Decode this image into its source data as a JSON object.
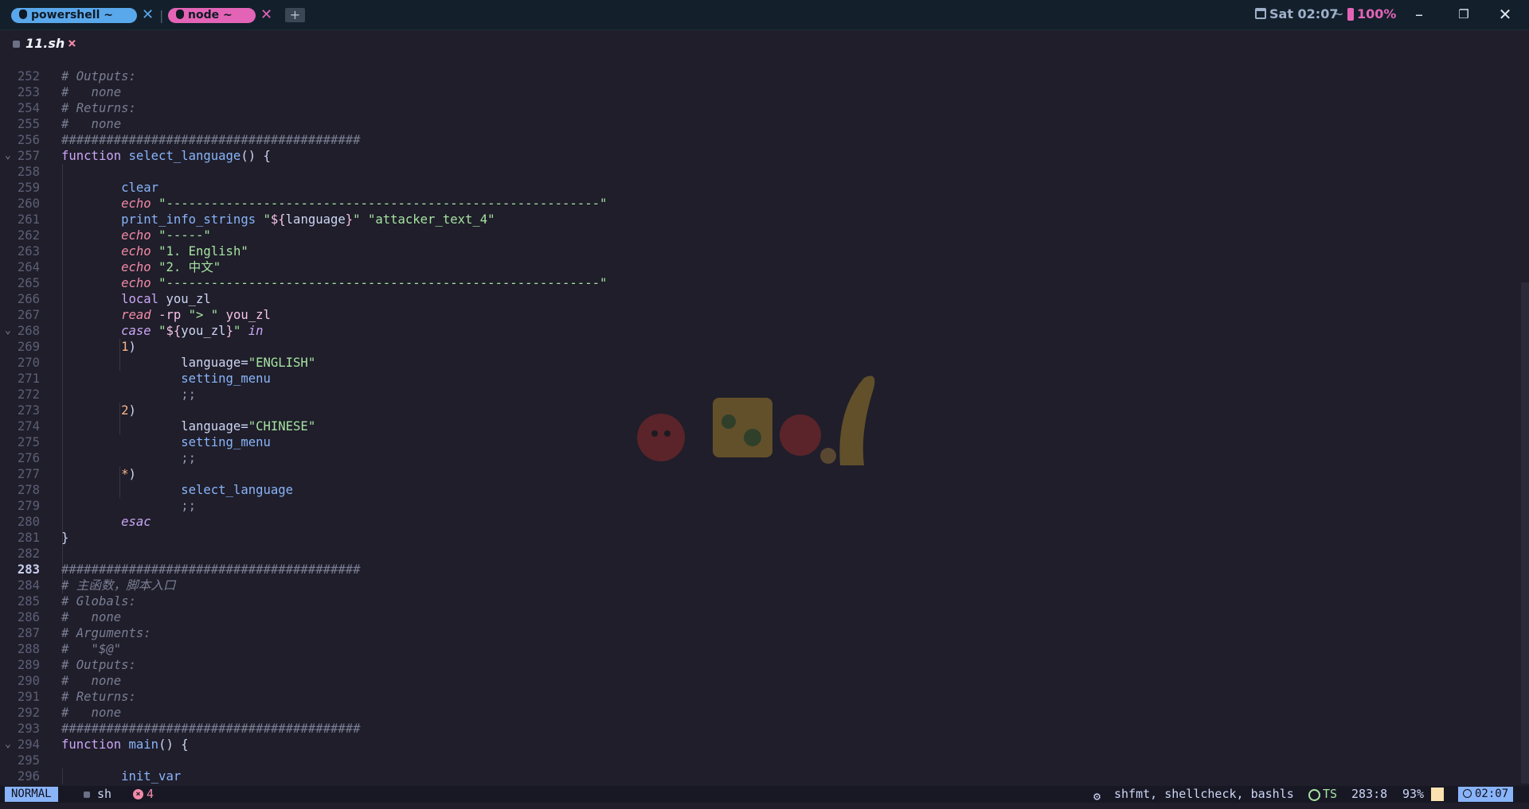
{
  "tabs": [
    {
      "label": "powershell ~",
      "color": "#5aa8ec"
    },
    {
      "label": "node ~",
      "color": "#e364b7"
    }
  ],
  "tab_separator": "|",
  "add_tab_label": "+",
  "top_status": {
    "datetime": "Sat 02:07",
    "tilde": "~",
    "battery": "100%"
  },
  "window_controls": {
    "minimize": "–",
    "maximize": "❐",
    "close": "✕"
  },
  "buffer": {
    "name": "11.sh",
    "close": "×"
  },
  "editor": {
    "lines": [
      {
        "n": "252",
        "t": [
          [
            "c-comment",
            "# Outputs:"
          ]
        ]
      },
      {
        "n": "253",
        "t": [
          [
            "c-comment",
            "#   none"
          ]
        ]
      },
      {
        "n": "254",
        "t": [
          [
            "c-comment",
            "# Returns:"
          ]
        ]
      },
      {
        "n": "255",
        "t": [
          [
            "c-comment",
            "#   none"
          ]
        ]
      },
      {
        "n": "256",
        "t": [
          [
            "c-hash",
            "########################################"
          ]
        ]
      },
      {
        "n": "257",
        "fold": true,
        "t": [
          [
            "c-kw",
            "function "
          ],
          [
            "c-fn",
            "select_language"
          ],
          [
            "c-plain",
            "() {"
          ]
        ]
      },
      {
        "n": "258",
        "t": []
      },
      {
        "n": "259",
        "t": [
          [
            "c-plain",
            "        "
          ],
          [
            "c-fn",
            "clear"
          ]
        ]
      },
      {
        "n": "260",
        "t": [
          [
            "c-plain",
            "        "
          ],
          [
            "c-builtin",
            "echo"
          ],
          [
            "c-plain",
            " "
          ],
          [
            "c-str",
            "\"----------------------------------------------------------\""
          ]
        ]
      },
      {
        "n": "261",
        "t": [
          [
            "c-plain",
            "        "
          ],
          [
            "c-fn",
            "print_info_strings"
          ],
          [
            "c-plain",
            " "
          ],
          [
            "c-str",
            "\""
          ],
          [
            "c-var",
            "${"
          ],
          [
            "c-plain",
            "language"
          ],
          [
            "c-var",
            "}"
          ],
          [
            "c-str",
            "\" \"attacker_text_4\""
          ]
        ]
      },
      {
        "n": "262",
        "t": [
          [
            "c-plain",
            "        "
          ],
          [
            "c-builtin",
            "echo"
          ],
          [
            "c-plain",
            " "
          ],
          [
            "c-str",
            "\"-----\""
          ]
        ]
      },
      {
        "n": "263",
        "t": [
          [
            "c-plain",
            "        "
          ],
          [
            "c-builtin",
            "echo"
          ],
          [
            "c-plain",
            " "
          ],
          [
            "c-str",
            "\"1. English\""
          ]
        ]
      },
      {
        "n": "264",
        "t": [
          [
            "c-plain",
            "        "
          ],
          [
            "c-builtin",
            "echo"
          ],
          [
            "c-plain",
            " "
          ],
          [
            "c-str",
            "\"2. 中文\""
          ]
        ]
      },
      {
        "n": "265",
        "t": [
          [
            "c-plain",
            "        "
          ],
          [
            "c-builtin",
            "echo"
          ],
          [
            "c-plain",
            " "
          ],
          [
            "c-str",
            "\"----------------------------------------------------------\""
          ]
        ]
      },
      {
        "n": "266",
        "t": [
          [
            "c-plain",
            "        "
          ],
          [
            "c-kw",
            "local"
          ],
          [
            "c-plain",
            " you_zl"
          ]
        ]
      },
      {
        "n": "267",
        "t": [
          [
            "c-plain",
            "        "
          ],
          [
            "c-builtin",
            "read"
          ],
          [
            "c-plain",
            " "
          ],
          [
            "c-var",
            "-rp"
          ],
          [
            "c-plain",
            " "
          ],
          [
            "c-str",
            "\"> \""
          ],
          [
            "c-plain",
            " "
          ],
          [
            "c-var",
            "you_zl"
          ]
        ]
      },
      {
        "n": "268",
        "fold": true,
        "t": [
          [
            "c-plain",
            "        "
          ],
          [
            "c-ctl",
            "case"
          ],
          [
            "c-plain",
            " "
          ],
          [
            "c-str",
            "\""
          ],
          [
            "c-var",
            "${"
          ],
          [
            "c-plain",
            "you_zl"
          ],
          [
            "c-var",
            "}"
          ],
          [
            "c-str",
            "\""
          ],
          [
            "c-plain",
            " "
          ],
          [
            "c-ctl",
            "in"
          ]
        ]
      },
      {
        "n": "269",
        "t": [
          [
            "c-plain",
            "        "
          ],
          [
            "c-num",
            "1"
          ],
          [
            "c-plain",
            ")"
          ]
        ]
      },
      {
        "n": "270",
        "t": [
          [
            "c-plain",
            "                language="
          ],
          [
            "c-str",
            "\"ENGLISH\""
          ]
        ]
      },
      {
        "n": "271",
        "t": [
          [
            "c-plain",
            "                "
          ],
          [
            "c-fn",
            "setting_menu"
          ]
        ]
      },
      {
        "n": "272",
        "t": [
          [
            "c-plain",
            "                "
          ],
          [
            "c-punct",
            ";;"
          ]
        ]
      },
      {
        "n": "273",
        "t": [
          [
            "c-plain",
            "        "
          ],
          [
            "c-num",
            "2"
          ],
          [
            "c-plain",
            ")"
          ]
        ]
      },
      {
        "n": "274",
        "t": [
          [
            "c-plain",
            "                language="
          ],
          [
            "c-str",
            "\"CHINESE\""
          ]
        ]
      },
      {
        "n": "275",
        "t": [
          [
            "c-plain",
            "                "
          ],
          [
            "c-fn",
            "setting_menu"
          ]
        ]
      },
      {
        "n": "276",
        "t": [
          [
            "c-plain",
            "                "
          ],
          [
            "c-punct",
            ";;"
          ]
        ]
      },
      {
        "n": "277",
        "t": [
          [
            "c-plain",
            "        "
          ],
          [
            "c-num",
            "*"
          ],
          [
            "c-plain",
            ")"
          ]
        ]
      },
      {
        "n": "278",
        "t": [
          [
            "c-plain",
            "                "
          ],
          [
            "c-fn",
            "select_language"
          ]
        ]
      },
      {
        "n": "279",
        "t": [
          [
            "c-plain",
            "                "
          ],
          [
            "c-punct",
            ";;"
          ]
        ]
      },
      {
        "n": "280",
        "t": [
          [
            "c-plain",
            "        "
          ],
          [
            "c-ctl",
            "esac"
          ]
        ]
      },
      {
        "n": "281",
        "t": [
          [
            "c-plain",
            "}"
          ]
        ]
      },
      {
        "n": "282",
        "t": []
      },
      {
        "n": "283",
        "current": true,
        "t": [
          [
            "c-hash",
            "########################################"
          ]
        ]
      },
      {
        "n": "284",
        "t": [
          [
            "c-comment",
            "# 主函数，脚本入口"
          ]
        ]
      },
      {
        "n": "285",
        "t": [
          [
            "c-comment",
            "# Globals:"
          ]
        ]
      },
      {
        "n": "286",
        "t": [
          [
            "c-comment",
            "#   none"
          ]
        ]
      },
      {
        "n": "287",
        "t": [
          [
            "c-comment",
            "# Arguments:"
          ]
        ]
      },
      {
        "n": "288",
        "t": [
          [
            "c-comment",
            "#   \"$@\""
          ]
        ]
      },
      {
        "n": "289",
        "t": [
          [
            "c-comment",
            "# Outputs:"
          ]
        ]
      },
      {
        "n": "290",
        "t": [
          [
            "c-comment",
            "#   none"
          ]
        ]
      },
      {
        "n": "291",
        "t": [
          [
            "c-comment",
            "# Returns:"
          ]
        ]
      },
      {
        "n": "292",
        "t": [
          [
            "c-comment",
            "#   none"
          ]
        ]
      },
      {
        "n": "293",
        "t": [
          [
            "c-hash",
            "########################################"
          ]
        ]
      },
      {
        "n": "294",
        "fold": true,
        "t": [
          [
            "c-kw",
            "function "
          ],
          [
            "c-fn",
            "main"
          ],
          [
            "c-plain",
            "() {"
          ]
        ]
      },
      {
        "n": "295",
        "t": []
      },
      {
        "n": "296",
        "t": [
          [
            "c-plain",
            "        "
          ],
          [
            "c-fn",
            "init_var"
          ]
        ]
      }
    ]
  },
  "statusline": {
    "mode": "NORMAL",
    "filetype": "sh",
    "errors": "4",
    "error_icon": "×",
    "lsp": "shfmt, shellcheck, bashls",
    "treesitter": "TS",
    "position": "283:8",
    "percent": "93%",
    "time": "02:07"
  },
  "colors": {
    "accent": "#89b4fa",
    "tab_powershell": "#5aa8ec",
    "tab_node": "#e364b7",
    "background": "#1f1e2a"
  }
}
